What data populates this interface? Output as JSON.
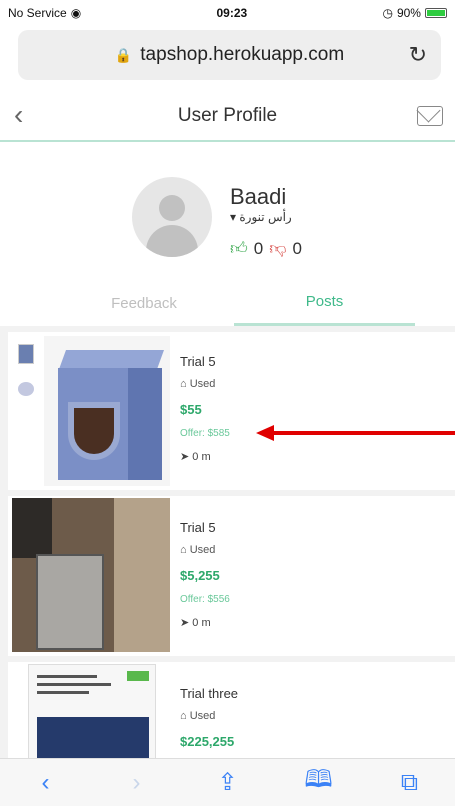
{
  "status_bar": {
    "carrier": "No Service",
    "time": "09:23",
    "battery": "90%",
    "battery_fraction": 0.9
  },
  "browser": {
    "url": "tapshop.herokuapp.com"
  },
  "header": {
    "title": "User Profile"
  },
  "profile": {
    "name": "Baadi",
    "location": "رأس تنورة",
    "likes": "0",
    "dislikes": "0"
  },
  "tabs": {
    "feedback": "Feedback",
    "posts": "Posts"
  },
  "posts": [
    {
      "title": "Trial 5",
      "condition": "Used",
      "price": "$55",
      "offer": "Offer: $585",
      "distance": "0 m"
    },
    {
      "title": "Trial 5",
      "condition": "Used",
      "price": "$5,255",
      "offer": "Offer: $556",
      "distance": "0 m"
    },
    {
      "title": "Trial three",
      "condition": "Used",
      "price": "$225,255"
    }
  ],
  "colors": {
    "accent": "#3fb98a",
    "price": "#2ea86b",
    "arrow": "#e00000",
    "toolbar_icon": "#3b82f6"
  }
}
